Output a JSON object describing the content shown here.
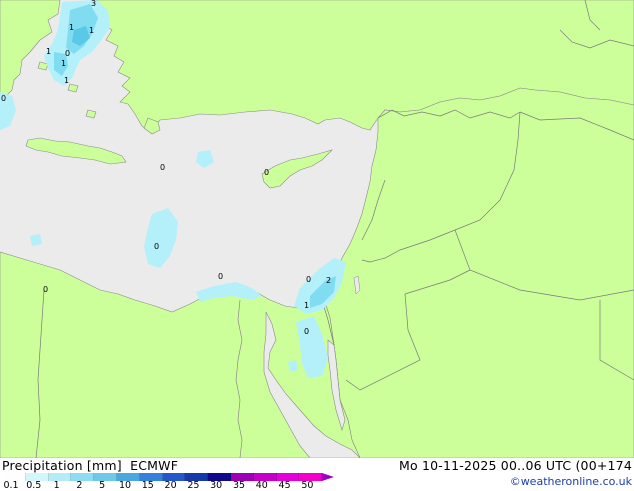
{
  "colors": {
    "sea": "#ebebeb",
    "land": "#ccff99",
    "border": "#7a7a7a",
    "precip_light": "#b3f0fa",
    "precip_mid": "#80dcf0",
    "precip_strong": "#5ac8e8"
  },
  "map_labels": [
    "3",
    "1",
    "1",
    "1",
    "1",
    "1",
    "0",
    "0",
    "0",
    "0",
    "0",
    "0",
    "0",
    "0",
    "2",
    "1",
    "0"
  ],
  "footer": {
    "title": "Precipitation [mm]  ECMWF",
    "datetime": "Mo 10-11-2025 00..06 UTC (00+174",
    "credit": "©weatheronline.co.uk"
  },
  "legend": {
    "ticks": [
      "0.1",
      "0.5",
      "1",
      "2",
      "5",
      "10",
      "15",
      "20",
      "25",
      "30",
      "35",
      "40",
      "45",
      "50"
    ],
    "colors": [
      "#fefefe",
      "#d2f6fa",
      "#b2ecf8",
      "#8cdcf2",
      "#6ccae8",
      "#4aa8e0",
      "#3580d8",
      "#2458c8",
      "#1838a8",
      "#100a8a",
      "#9c00b4",
      "#c400c8",
      "#e400d8",
      "#f000c8"
    ]
  }
}
